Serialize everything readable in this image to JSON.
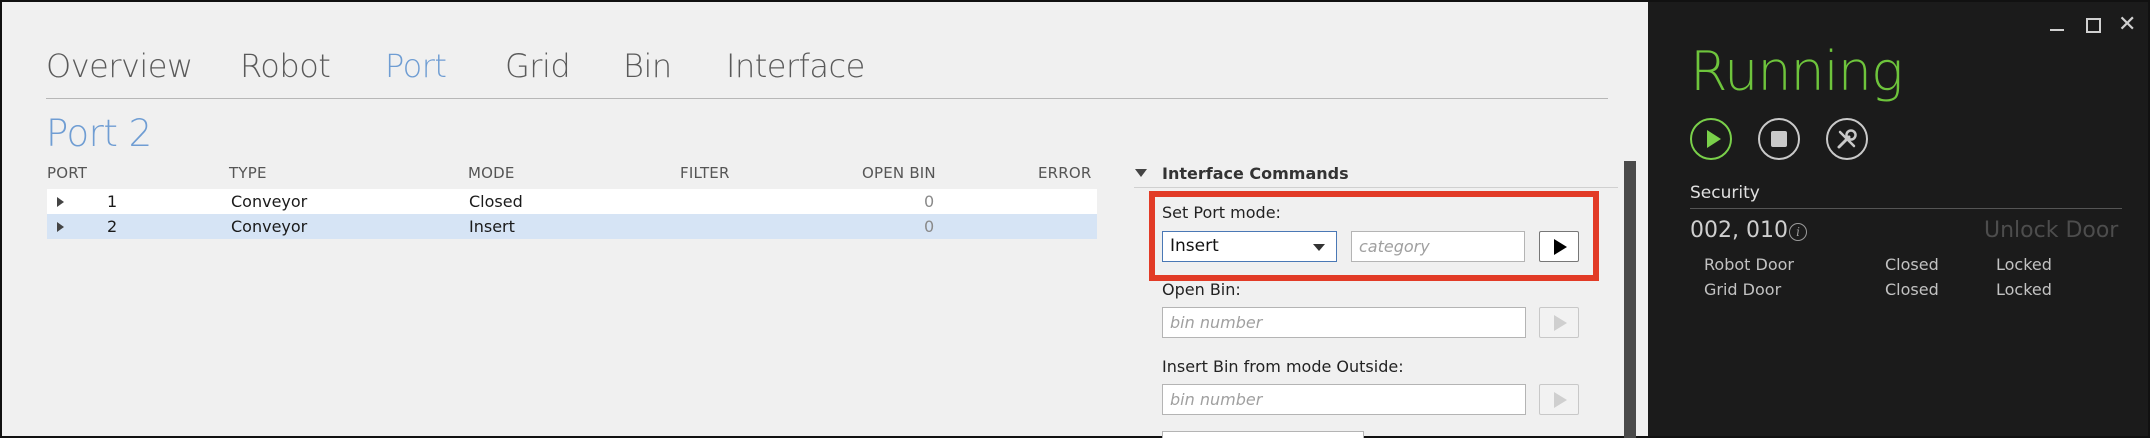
{
  "tabs": [
    {
      "label": "Overview",
      "active": false
    },
    {
      "label": "Robot",
      "active": false
    },
    {
      "label": "Port",
      "active": true
    },
    {
      "label": "Grid",
      "active": false
    },
    {
      "label": "Bin",
      "active": false
    },
    {
      "label": "Interface",
      "active": false
    }
  ],
  "page_title": "Port 2",
  "port_table": {
    "columns": [
      "PORT",
      "TYPE",
      "MODE",
      "FILTER",
      "OPEN BIN",
      "ERROR"
    ],
    "rows": [
      {
        "port": "1",
        "type": "Conveyor",
        "mode": "Closed",
        "filter": "",
        "open_bin": "0",
        "error": "",
        "selected": false
      },
      {
        "port": "2",
        "type": "Conveyor",
        "mode": "Insert",
        "filter": "",
        "open_bin": "0",
        "error": "",
        "selected": true
      }
    ]
  },
  "interface_commands": {
    "title": "Interface Commands",
    "set_port_mode": {
      "label": "Set Port mode:",
      "mode_value": "Insert",
      "category_placeholder": "category"
    },
    "open_bin": {
      "label": "Open Bin:",
      "placeholder": "bin number"
    },
    "insert_bin": {
      "label": "Insert Bin from mode Outside:",
      "placeholder": "bin number"
    }
  },
  "side_panel": {
    "status": "Running",
    "status_color": "#6ec43c",
    "controls": [
      "play-icon",
      "stop-icon",
      "tools-icon"
    ],
    "security": {
      "title": "Security",
      "id": "002, 010",
      "unlock_label": "Unlock Door",
      "doors": [
        {
          "name": "Robot Door",
          "state": "Closed",
          "lock": "Locked"
        },
        {
          "name": "Grid Door",
          "state": "Closed",
          "lock": "Locked"
        }
      ]
    }
  },
  "colors": {
    "accent": "#6f9dd3",
    "highlight": "#e23b26",
    "selected_row": "#d6e4f5"
  }
}
